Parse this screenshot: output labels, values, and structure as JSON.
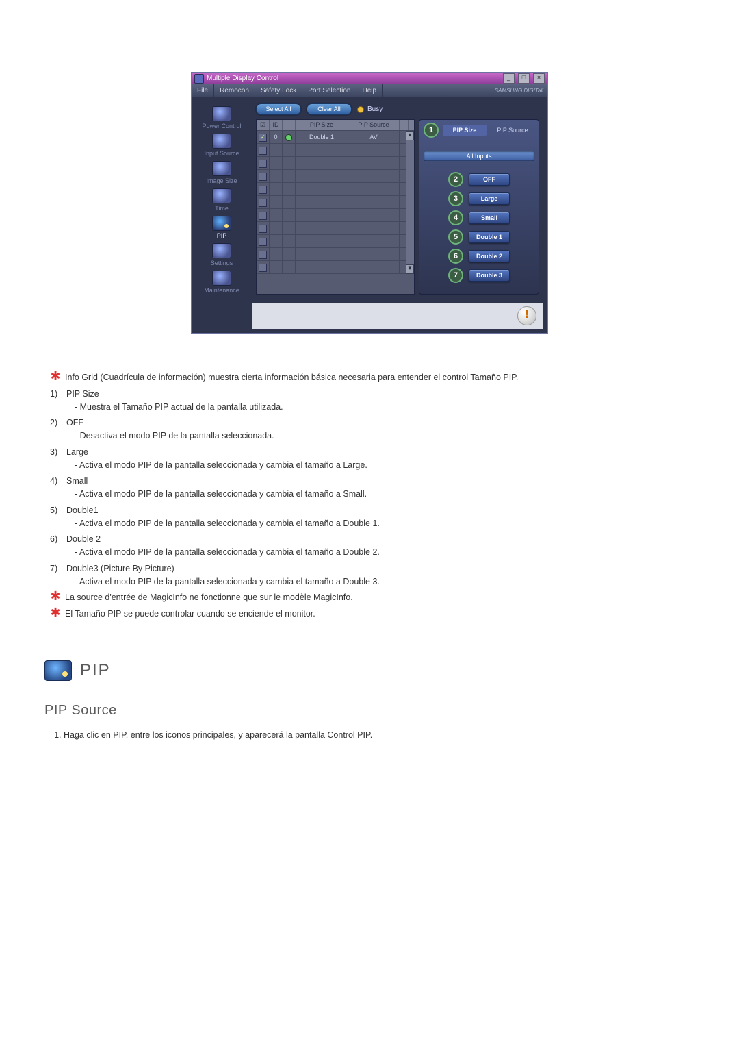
{
  "app_window": {
    "title": "Multiple Display Control",
    "menu": [
      "File",
      "Remocon",
      "Safety Lock",
      "Port Selection",
      "Help"
    ],
    "brand": "SAMSUNG DIGITall",
    "window_buttons": {
      "min": "_",
      "max": "□",
      "close": "×"
    },
    "sidebar": [
      {
        "label": "Power Control",
        "icon": "power-icon"
      },
      {
        "label": "Input Source",
        "icon": "input-icon"
      },
      {
        "label": "Image Size",
        "icon": "imagesize-icon"
      },
      {
        "label": "Time",
        "icon": "time-icon"
      },
      {
        "label": "PIP",
        "icon": "pip-icon",
        "active": true
      },
      {
        "label": "Settings",
        "icon": "settings-icon"
      },
      {
        "label": "Maintenance",
        "icon": "maintenance-icon"
      }
    ],
    "toolbar": {
      "select_all": "Select All",
      "clear_all": "Clear All",
      "busy_label": "Busy"
    },
    "grid": {
      "headers": {
        "chk": "☑",
        "id": "ID",
        "status": "",
        "size": "PIP Size",
        "source": "PIP Source"
      },
      "rows": [
        {
          "checked": true,
          "id": "0",
          "status": "on",
          "size": "Double 1",
          "source": "AV"
        },
        {
          "checked": false,
          "id": "",
          "status": "",
          "size": "",
          "source": ""
        },
        {
          "checked": false,
          "id": "",
          "status": "",
          "size": "",
          "source": ""
        },
        {
          "checked": false,
          "id": "",
          "status": "",
          "size": "",
          "source": ""
        },
        {
          "checked": false,
          "id": "",
          "status": "",
          "size": "",
          "source": ""
        },
        {
          "checked": false,
          "id": "",
          "status": "",
          "size": "",
          "source": ""
        },
        {
          "checked": false,
          "id": "",
          "status": "",
          "size": "",
          "source": ""
        },
        {
          "checked": false,
          "id": "",
          "status": "",
          "size": "",
          "source": ""
        },
        {
          "checked": false,
          "id": "",
          "status": "",
          "size": "",
          "source": ""
        },
        {
          "checked": false,
          "id": "",
          "status": "",
          "size": "",
          "source": ""
        },
        {
          "checked": false,
          "id": "",
          "status": "",
          "size": "",
          "source": ""
        }
      ]
    },
    "pip_panel": {
      "tabs": {
        "size": "PIP Size",
        "source": "PIP Source"
      },
      "badge_tabs": "1",
      "all_inputs": "All Inputs",
      "options": [
        {
          "n": "2",
          "label": "OFF"
        },
        {
          "n": "3",
          "label": "Large"
        },
        {
          "n": "4",
          "label": "Small"
        },
        {
          "n": "5",
          "label": "Double 1"
        },
        {
          "n": "6",
          "label": "Double 2"
        },
        {
          "n": "7",
          "label": "Double 3"
        }
      ]
    },
    "footer_alert": "!"
  },
  "doc": {
    "intro_note": "Info Grid (Cuadrícula de información) muestra cierta información básica necesaria para entender el control Tamaño PIP.",
    "items": [
      {
        "n": "1)",
        "title": "PIP Size",
        "sub": "- Muestra el Tamaño PIP actual de la pantalla utilizada."
      },
      {
        "n": "2)",
        "title": "OFF",
        "sub": "- Desactiva el modo PIP de la pantalla seleccionada."
      },
      {
        "n": "3)",
        "title": "Large",
        "sub": "- Activa el modo PIP de la pantalla seleccionada y cambia el tamaño a Large."
      },
      {
        "n": "4)",
        "title": "Small",
        "sub": "- Activa el modo PIP de la pantalla seleccionada y cambia el tamaño a Small."
      },
      {
        "n": "5)",
        "title": "Double1",
        "sub": "- Activa el modo PIP de la pantalla seleccionada y cambia el tamaño a Double 1."
      },
      {
        "n": "6)",
        "title": "Double 2",
        "sub": "- Activa el modo PIP de la pantalla seleccionada y cambia el tamaño a Double 2."
      },
      {
        "n": "7)",
        "title": "Double3 (Picture By Picture)",
        "sub": "- Activa el modo PIP de la pantalla seleccionada y cambia el tamaño a Double 3."
      }
    ],
    "note1": "La source d'entrée de MagicInfo ne fonctionne que sur le modèle MagicInfo.",
    "note2": "El Tamaño PIP se puede controlar cuando se enciende el monitor.",
    "section_label": "PIP",
    "sub_heading": "PIP Source",
    "body_1": "Haga clic en PIP, entre los iconos principales, y aparecerá la pantalla Control PIP."
  }
}
